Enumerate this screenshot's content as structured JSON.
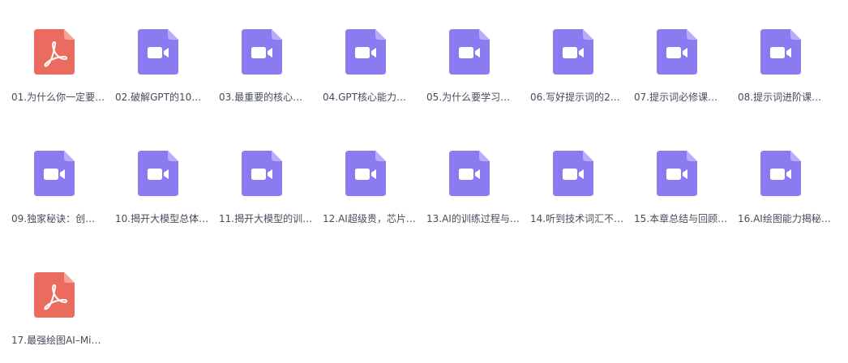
{
  "colors": {
    "video": "#8a7cf0",
    "video_fold": "#b7adfa",
    "pdf": "#eb6b5e",
    "pdf_fold": "#f4a49b",
    "label": "#454d5a"
  },
  "files": [
    {
      "name": "01.为什么你一定要…",
      "type": "pdf",
      "icon": "pdf-icon"
    },
    {
      "name": "02.破解GPT的10…",
      "type": "video",
      "icon": "video-icon"
    },
    {
      "name": "03.最重要的核心…",
      "type": "video",
      "icon": "video-icon"
    },
    {
      "name": "04.GPT核心能力…",
      "type": "video",
      "icon": "video-icon"
    },
    {
      "name": "05.为什么要学习…",
      "type": "video",
      "icon": "video-icon"
    },
    {
      "name": "06.写好提示词的2…",
      "type": "video",
      "icon": "video-icon"
    },
    {
      "name": "07.提示词必修课…",
      "type": "video",
      "icon": "video-icon"
    },
    {
      "name": "08.提示词进阶课…",
      "type": "video",
      "icon": "video-icon"
    },
    {
      "name": "09.独家秘诀：创…",
      "type": "video",
      "icon": "video-icon"
    },
    {
      "name": "10.揭开大模型总体…",
      "type": "video",
      "icon": "video-icon"
    },
    {
      "name": "11.揭开大模型的训…",
      "type": "video",
      "icon": "video-icon"
    },
    {
      "name": "12.AI超级贵，芯片…",
      "type": "video",
      "icon": "video-icon"
    },
    {
      "name": "13.AI的训练过程与…",
      "type": "video",
      "icon": "video-icon"
    },
    {
      "name": "14.听到技术词汇不…",
      "type": "video",
      "icon": "video-icon"
    },
    {
      "name": "15.本章总结与回顾…",
      "type": "video",
      "icon": "video-icon"
    },
    {
      "name": "16.AI绘图能力揭秘…",
      "type": "video",
      "icon": "video-icon"
    },
    {
      "name": "17.最强绘图AI–Mi…",
      "type": "pdf",
      "icon": "pdf-icon"
    }
  ]
}
